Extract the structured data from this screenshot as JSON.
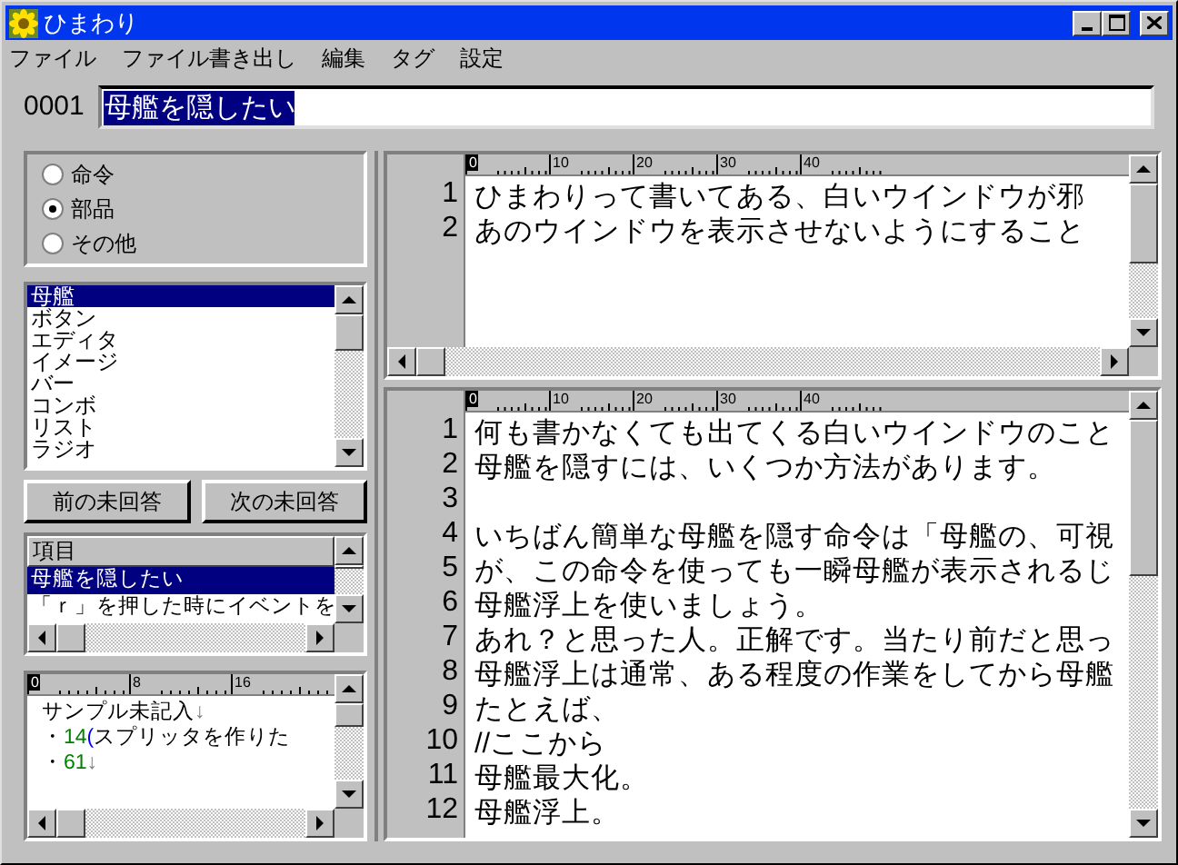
{
  "window": {
    "title": "ひまわり"
  },
  "menu": [
    "ファイル",
    "ファイル書き出し",
    "編集",
    "タグ",
    "設定"
  ],
  "record": {
    "number": "0001",
    "value": "母艦を隠したい"
  },
  "category": [
    {
      "label": "命令",
      "selected": false
    },
    {
      "label": "部品",
      "selected": true
    },
    {
      "label": "その他",
      "selected": false
    }
  ],
  "parts_list": [
    {
      "label": "母艦",
      "selected": true
    },
    {
      "label": "ボタン",
      "selected": false
    },
    {
      "label": "エディタ",
      "selected": false
    },
    {
      "label": "イメージ",
      "selected": false
    },
    {
      "label": "バー",
      "selected": false
    },
    {
      "label": "コンボ",
      "selected": false
    },
    {
      "label": "リスト",
      "selected": false
    },
    {
      "label": "ラジオ",
      "selected": false
    }
  ],
  "buttons": [
    "前の未回答",
    "次の未回答"
  ],
  "items": {
    "header": "項目",
    "rows": [
      {
        "label": "母艦を隠したい",
        "selected": true
      },
      {
        "label": "「ｒ」を押した時にイベントを",
        "selected": false
      }
    ]
  },
  "memo": {
    "ruler": [
      "0",
      "8",
      "16"
    ],
    "lines": [
      [
        {
          "kind": "plain",
          "text": "サンプル未記入"
        },
        {
          "kind": "mark",
          "text": "↓"
        }
      ],
      [
        {
          "kind": "plain",
          "text": "・"
        },
        {
          "kind": "number",
          "text": "14"
        },
        {
          "kind": "paren",
          "text": "("
        },
        {
          "kind": "plain",
          "text": "スプリッタを作りた"
        }
      ],
      [
        {
          "kind": "plain",
          "text": "・"
        },
        {
          "kind": "number",
          "text": "61"
        },
        {
          "kind": "mark",
          "text": "↓"
        }
      ]
    ]
  },
  "editors": [
    {
      "ruler": [
        "0",
        "10",
        "20",
        "30",
        "40"
      ],
      "lines": [
        {
          "number": "1",
          "text": "ひまわりって書いてある、白いウインドウが邪"
        },
        {
          "number": "2",
          "text": "あのウインドウを表示させないようにすること"
        }
      ]
    },
    {
      "ruler": [
        "0",
        "10",
        "20",
        "30",
        "40"
      ],
      "lines": [
        {
          "number": "1",
          "text": "何も書かなくても出てくる白いウインドウのこと"
        },
        {
          "number": "2",
          "text": "母艦を隠すには、いくつか方法があります。"
        },
        {
          "number": "3"
        },
        {
          "number": "4",
          "text": "いちばん簡単な母艦を隠す命令は「母艦の、可視"
        },
        {
          "number": "5",
          "text": "が、この命令を使っても一瞬母艦が表示されるじ"
        },
        {
          "number": "6",
          "text": "母艦浮上を使いましょう。"
        },
        {
          "number": "7",
          "text": "あれ？と思った人。正解です。当たり前だと思っ"
        },
        {
          "number": "8",
          "text": "母艦浮上は通常、ある程度の作業をしてから母艦"
        },
        {
          "number": "9",
          "text": "たとえば、"
        },
        {
          "number": "10",
          "text": "//ここから"
        },
        {
          "number": "11",
          "text": "母艦最大化。"
        },
        {
          "number": "12",
          "text": "母艦浮上。"
        }
      ]
    }
  ]
}
